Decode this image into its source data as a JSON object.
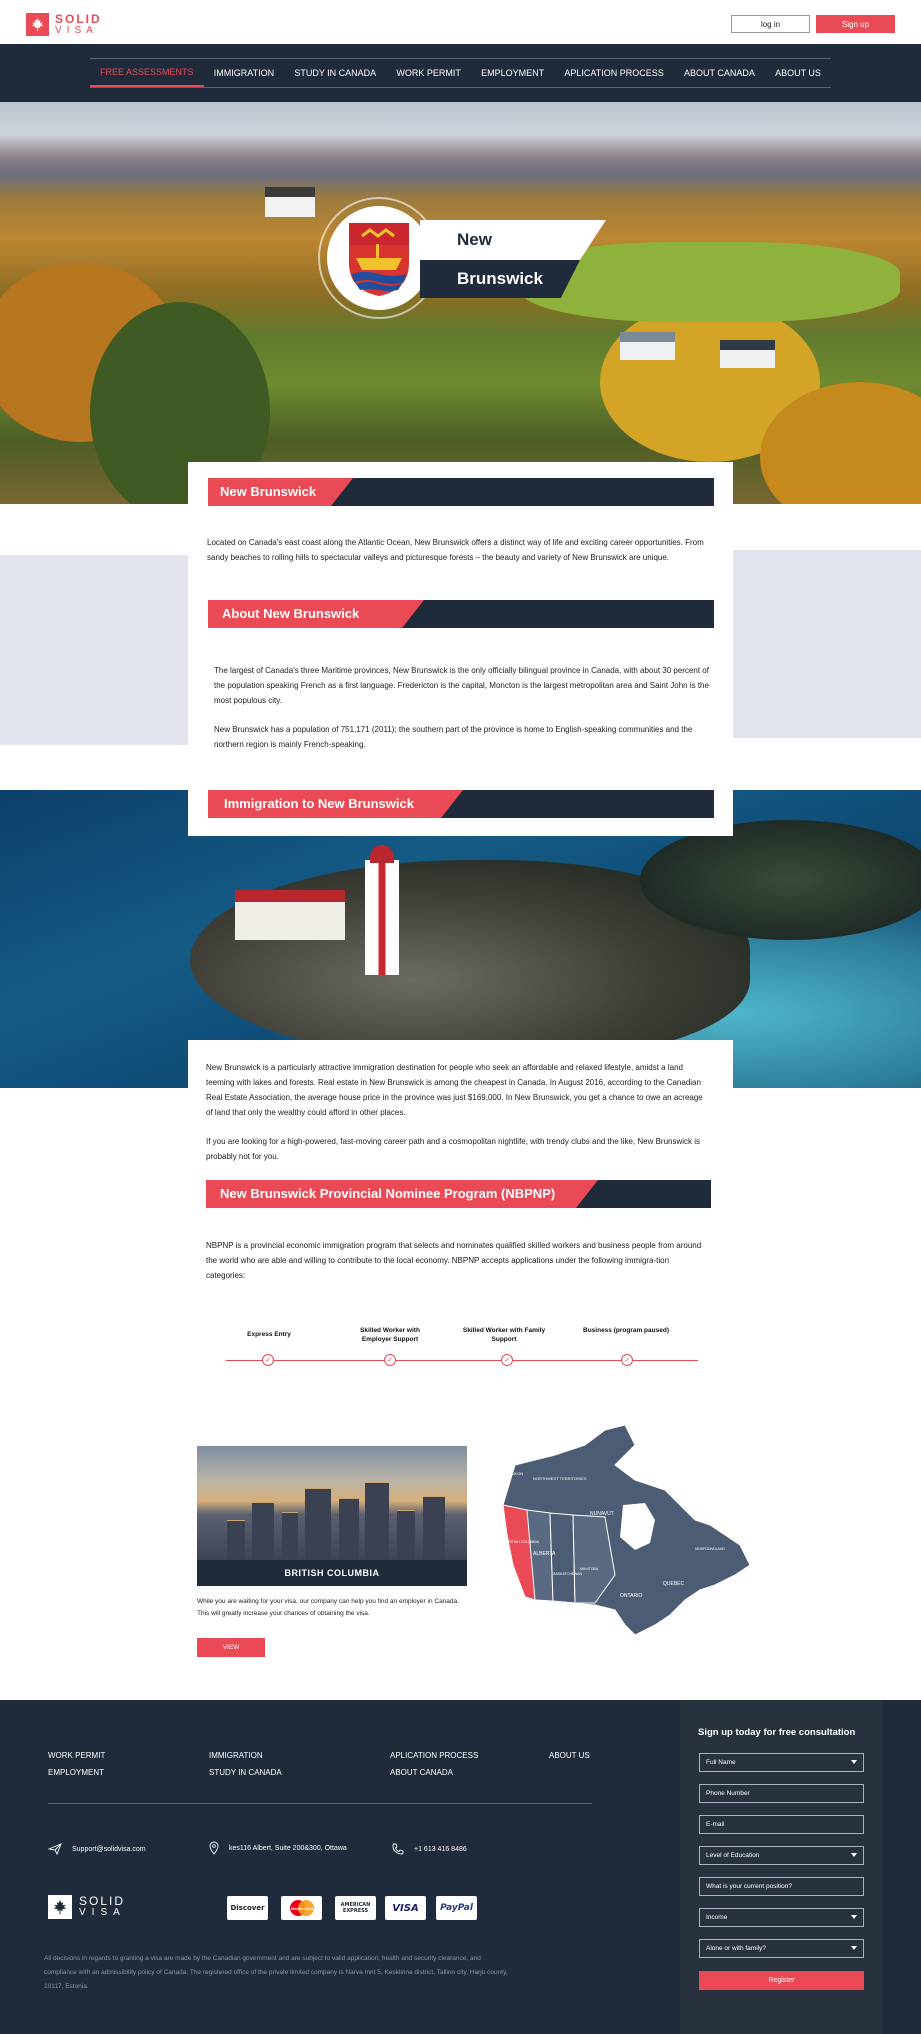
{
  "header": {
    "logo_line1": "SOLID",
    "logo_line2": "VISA",
    "login_label": "log in",
    "signup_label": "Sign up"
  },
  "nav": {
    "items": [
      {
        "label": "FREE ASSESSMENTS",
        "active": true
      },
      {
        "label": "IMMIGRATION"
      },
      {
        "label": "STUDY IN CANADA"
      },
      {
        "label": "WORK PERMIT"
      },
      {
        "label": "EMPLOYMENT"
      },
      {
        "label": "APLICATION PROCESS"
      },
      {
        "label": "ABOUT CANADA"
      },
      {
        "label": "ABOUT US"
      }
    ]
  },
  "hero": {
    "name_line1": "New",
    "name_line2": "Brunswick"
  },
  "sections": {
    "intro_title": "New Brunswick",
    "intro_text": "Located on Canada's east coast along the Atlantic Ocean, New Brunswick offers a distinct way of life and exciting career opportunities. From sandy beaches to rolling hills to spectacular valleys and picturesque forests – the beauty and variety of New Brunswick are unique.",
    "about_title": "About New Brunswick",
    "about_text1": "The largest of Canada's three Maritime provinces, New Brunswick is the only officially bilingual province in Canada, with about 30 percent of the population speaking French as a first language. Fredericton is the capital, Moncton is the largest metropolitan area and Saint John is the most populous city.",
    "about_text2": "New Brunswick has a population of 751,171 (2011); the southern part of the province is home to English-speaking communities and the northern region is mainly French-speaking.",
    "immigration_title": "Immigration to New Brunswick",
    "immigration_text1": "New Brunswick is a particularly attractive immigration destination for people who seek an affordable and relaxed lifestyle, amidst a land teeming with lakes and forests. Real estate in New Brunswick is among the cheapest in Canada. In August 2016, according to the Canadian Real Estate Association, the average house price in the province was just $169,000. In New Brunswick, you get a chance to owe an acreage of land that only the wealthy could afford in other places.",
    "immigration_text2": "If you are looking for a high-powered, fast-moving career path and a cosmopolitan nightlife, with trendy clubs and the like, New Brunswick is probably not for you.",
    "nbpnp_title": "New Brunswick Provincial Nominee Program (NBPNP)",
    "nbpnp_text": "NBPNP is a provincial economic immigration program that selects and nominates qualified skilled workers and business people from around the world who are able and willing to contribute to the local economy. NBPNP accepts applications under the following immigra-tion categories:"
  },
  "steps": [
    {
      "label": "Express Entry"
    },
    {
      "label": "Skilled Worker with Employer Support"
    },
    {
      "label": "Skilled Worker with Family Support"
    },
    {
      "label": "Business (program paused)"
    }
  ],
  "province_card": {
    "title": "BRITISH COLUMBIA",
    "text": "While you are waiting for your visa, our company can help you find an employer in Canada. This will greatly increase your chances of obtaining the visa.",
    "button": "VIEW"
  },
  "map": {
    "labels": [
      "YUKON",
      "NORTHWEST TERRITORIES",
      "NUNAVUT",
      "BRITISH COLUMBIA",
      "ALBERTA",
      "SASKATCHEWAN",
      "MANITOBA",
      "ONTARIO",
      "QUEBEC",
      "NEWFOUNDLAND"
    ],
    "highlight_color": "#ea4a55",
    "base_color": "#4c5c74"
  },
  "footer": {
    "links": [
      "WORK PERMIT",
      "EMPLOYMENT",
      "IMMIGRATION",
      "STUDY IN CANADA",
      "APLICATION PROCESS",
      "ABOUT CANADA",
      "ABOUT US"
    ],
    "email": "Support@solidvisa.com",
    "address": "kes116 Albert, Suite 200&300, Ottawa",
    "phone": "+1 613 416 8486",
    "logo_line1": "SOLID",
    "logo_line2": "VISA",
    "payments": [
      "Discover",
      "MasterCard",
      "AMERICAN EXPRESS",
      "VISA",
      "PayPal"
    ],
    "disclaimer": "All decisions in regards to granting a visa are made by the Canadian government and are subject to valid application, health and security clearance, and compliance with an admissibility policy of Canada. The registered office of the private limited company is Narva mnt 5, Kesklinna district, Tallinn city, Harju county, 10117, Estonia."
  },
  "form": {
    "title": "Sign up today for free consultation",
    "fields": [
      {
        "placeholder": "Full Name",
        "dropdown": true
      },
      {
        "placeholder": "Phone Number"
      },
      {
        "placeholder": "E-mail"
      },
      {
        "placeholder": "Level of Education",
        "dropdown": true
      },
      {
        "placeholder": "What is your current position?"
      },
      {
        "placeholder": "Income",
        "dropdown": true
      },
      {
        "placeholder": "Alone or with family?",
        "dropdown": true
      }
    ],
    "submit": "Register"
  },
  "colors": {
    "accent": "#ea4a55",
    "navy": "#1f2a3a",
    "grey_panel": "#e3e5ee"
  }
}
